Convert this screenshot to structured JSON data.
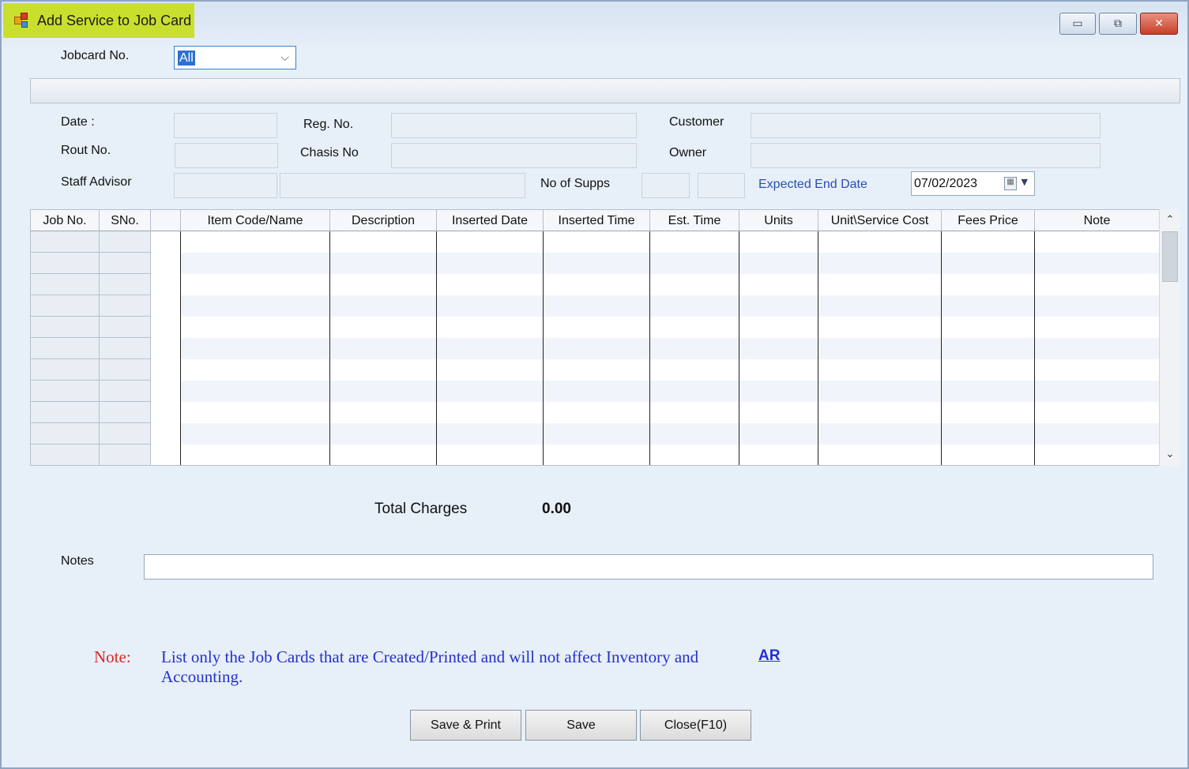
{
  "window": {
    "title": "Add Service to Job Card"
  },
  "header": {
    "jobcard_label": "Jobcard No.",
    "jobcard_value": "All",
    "date_label": "Date :",
    "rout_label": "Rout No.",
    "staff_label": "Staff Advisor",
    "reg_label": "Reg. No.",
    "chasis_label": "Chasis No",
    "supps_label": "No of Supps",
    "customer_label": "Customer",
    "owner_label": "Owner",
    "expected_label": "Expected End Date",
    "expected_value": "07/02/2023"
  },
  "grid": {
    "columns": [
      "Job No.",
      "SNo.",
      "",
      "Item Code/Name",
      "Description",
      "Inserted  Date",
      "Inserted Time",
      "Est. Time",
      "Units",
      "Unit\\Service Cost",
      "Fees Price",
      "Note"
    ],
    "row_count": 11
  },
  "totals": {
    "label": "Total Charges",
    "value": "0.00"
  },
  "notes": {
    "label": "Notes",
    "value": ""
  },
  "note": {
    "prefix": "Note:",
    "text": "List only the Job Cards that are Created/Printed and will not affect Inventory and Accounting.",
    "link": "AR"
  },
  "buttons": {
    "save_print": "Save & Print",
    "save": "Save",
    "close": "Close(F10)"
  },
  "colors": {
    "title_highlight": "#c9df2d",
    "note_red": "#e02424",
    "note_blue": "#2430d0"
  }
}
